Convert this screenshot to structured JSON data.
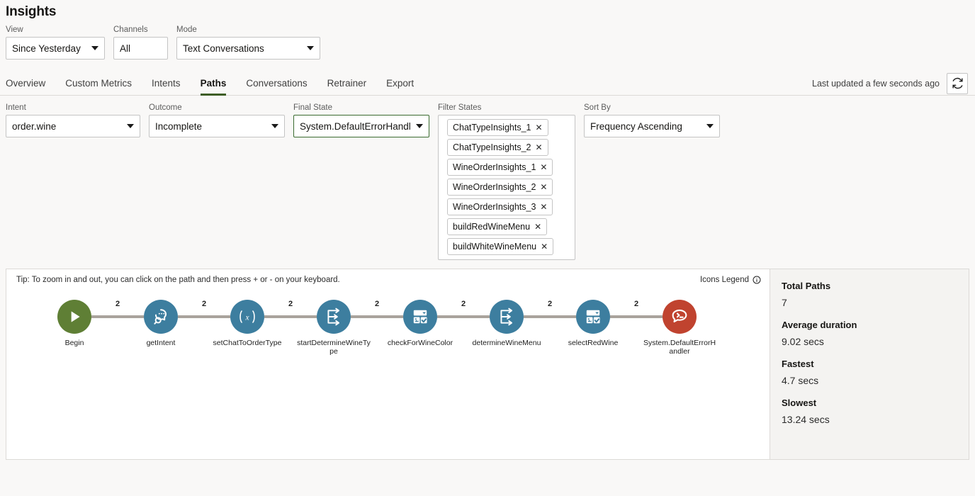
{
  "header": {
    "title": "Insights"
  },
  "topbar": {
    "view": {
      "label": "View",
      "value": "Since Yesterday"
    },
    "channels": {
      "label": "Channels",
      "value": "All"
    },
    "mode": {
      "label": "Mode",
      "value": "Text Conversations"
    }
  },
  "tabs": {
    "items": [
      {
        "label": "Overview",
        "active": false
      },
      {
        "label": "Custom Metrics",
        "active": false
      },
      {
        "label": "Intents",
        "active": false
      },
      {
        "label": "Paths",
        "active": true
      },
      {
        "label": "Conversations",
        "active": false
      },
      {
        "label": "Retrainer",
        "active": false
      },
      {
        "label": "Export",
        "active": false
      }
    ],
    "updated_text": "Last updated a few seconds ago",
    "refresh_icon": "refresh-icon"
  },
  "filters": {
    "intent": {
      "label": "Intent",
      "value": "order.wine"
    },
    "outcome": {
      "label": "Outcome",
      "value": "Incomplete"
    },
    "final_state": {
      "label": "Final State",
      "value": "System.DefaultErrorHandl"
    },
    "filter_states": {
      "label": "Filter States",
      "chips": [
        "ChatTypeInsights_1",
        "ChatTypeInsights_2",
        "WineOrderInsights_1",
        "WineOrderInsights_2",
        "WineOrderInsights_3",
        "buildRedWineMenu",
        "buildWhiteWineMenu"
      ],
      "remove_glyph": "✕"
    },
    "sort_by": {
      "label": "Sort By",
      "value": "Frequency Ascending"
    }
  },
  "diagram": {
    "tip": "Tip: To zoom in and out, you can click on the path and then press + or - on your keyboard.",
    "legend_label": "Icons Legend",
    "legend_icon": "info-icon",
    "colors": {
      "begin": "#5f7f35",
      "state": "#3d7e9f",
      "error": "#c0432f",
      "edge": "#a9a39c"
    },
    "nodes": [
      {
        "label": "Begin",
        "icon": "play-icon",
        "kind": "begin"
      },
      {
        "label": "getIntent",
        "icon": "intent-detect-icon",
        "kind": "state"
      },
      {
        "label": "setChatToOrderType",
        "icon": "variable-icon",
        "kind": "state"
      },
      {
        "label": "startDetermineWineType",
        "icon": "flow-icon",
        "kind": "state"
      },
      {
        "label": "checkForWineColor",
        "icon": "form-icon",
        "kind": "state"
      },
      {
        "label": "determineWineMenu",
        "icon": "flow-icon",
        "kind": "state"
      },
      {
        "label": "selectRedWine",
        "icon": "form-icon",
        "kind": "state"
      },
      {
        "label": "System.DefaultErrorHandler",
        "icon": "error-bubble-icon",
        "kind": "error"
      }
    ],
    "edge_labels": [
      "2",
      "2",
      "2",
      "2",
      "2",
      "2",
      "2"
    ]
  },
  "stats": [
    {
      "label": "Total Paths",
      "value": "7"
    },
    {
      "label": "Average duration",
      "value": "9.02 secs"
    },
    {
      "label": "Fastest",
      "value": "4.7 secs"
    },
    {
      "label": "Slowest",
      "value": "13.24 secs"
    }
  ]
}
